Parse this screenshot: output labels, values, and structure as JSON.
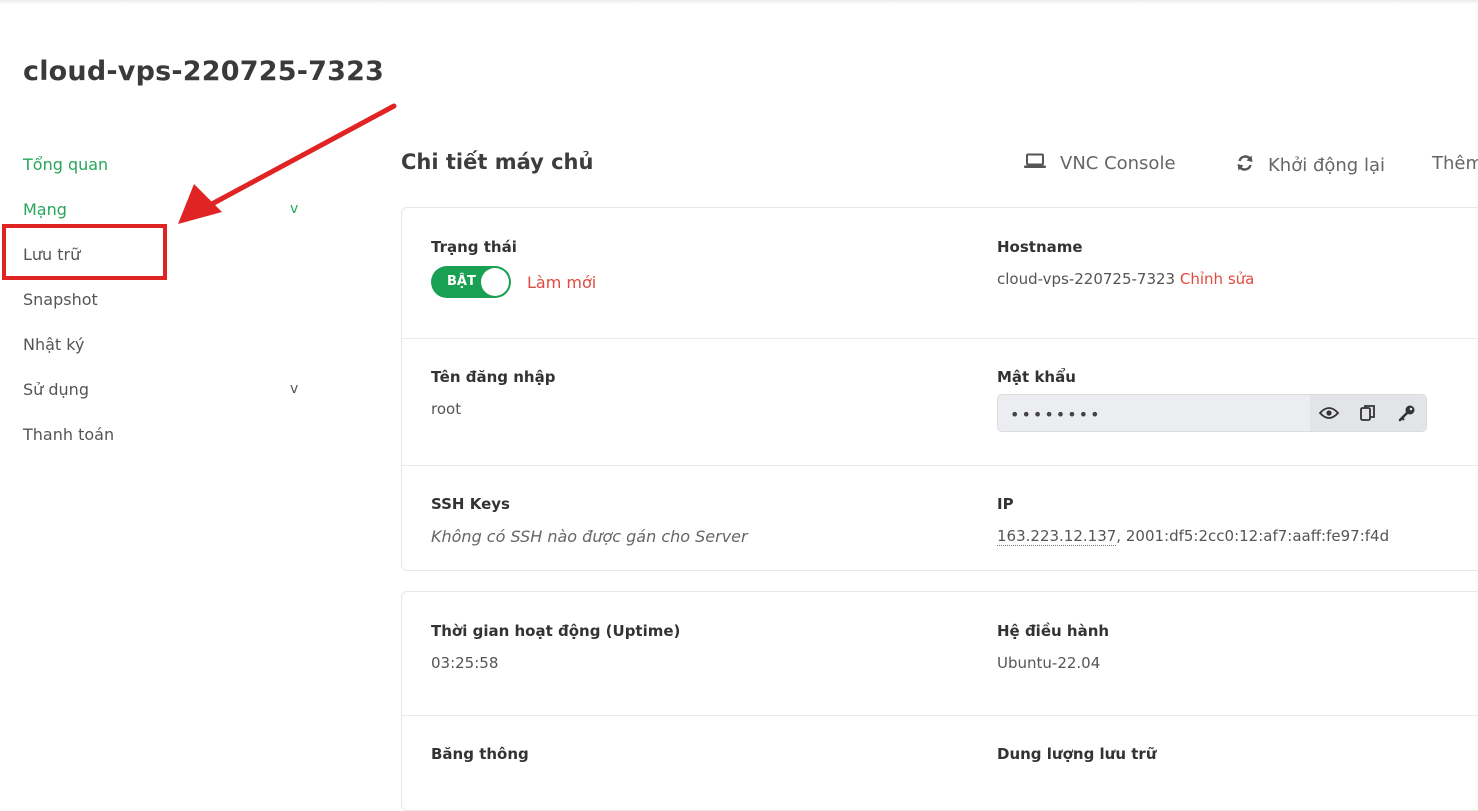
{
  "page": {
    "title": "cloud-vps-220725-7323"
  },
  "sidebar": {
    "items": [
      {
        "label": "Tổng quan"
      },
      {
        "label": "Mạng",
        "chevron": "v"
      },
      {
        "label": "Lưu trữ"
      },
      {
        "label": "Snapshot"
      },
      {
        "label": "Nhật ký"
      },
      {
        "label": "Sử dụng",
        "chevron": "v"
      },
      {
        "label": "Thanh toán"
      }
    ]
  },
  "section": {
    "title": "Chi tiết máy chủ",
    "actions": {
      "vnc": "VNC Console",
      "restart": "Khởi động lại",
      "more": "Thêm"
    }
  },
  "details": {
    "status_label": "Trạng thái",
    "status_toggle": "BẬT",
    "refresh_link": "Làm mới",
    "hostname_label": "Hostname",
    "hostname_value": "cloud-vps-220725-7323",
    "edit_link": "Chỉnh sửa",
    "username_label": "Tên đăng nhập",
    "username_value": "root",
    "password_label": "Mật khẩu",
    "password_masked": "••••••••",
    "ssh_label": "SSH Keys",
    "ssh_value": "Không có SSH nào được gán cho Server",
    "ip_label": "IP",
    "ipv4": "163.223.12.137",
    "ip_separator": ",",
    "ipv6": "2001:df5:2cc0:12:af7:aaff:fe97:f4d"
  },
  "details2": {
    "uptime_label": "Thời gian hoạt động (Uptime)",
    "uptime_value": "03:25:58",
    "os_label": "Hệ điều hành",
    "os_value": "Ubuntu-22.04",
    "bandwidth_label": "Băng thông",
    "storage_label": "Dung lượng lưu trữ"
  },
  "colors": {
    "accent_green": "#26a65b",
    "toggle_green": "#1aa053",
    "link_red": "#e04a3f",
    "annotation_red": "#e02424"
  },
  "icons": {
    "vnc": "laptop-icon",
    "restart": "refresh-icon",
    "show_password": "eye-icon",
    "copy": "copy-icon",
    "reset_password": "key-icon"
  }
}
